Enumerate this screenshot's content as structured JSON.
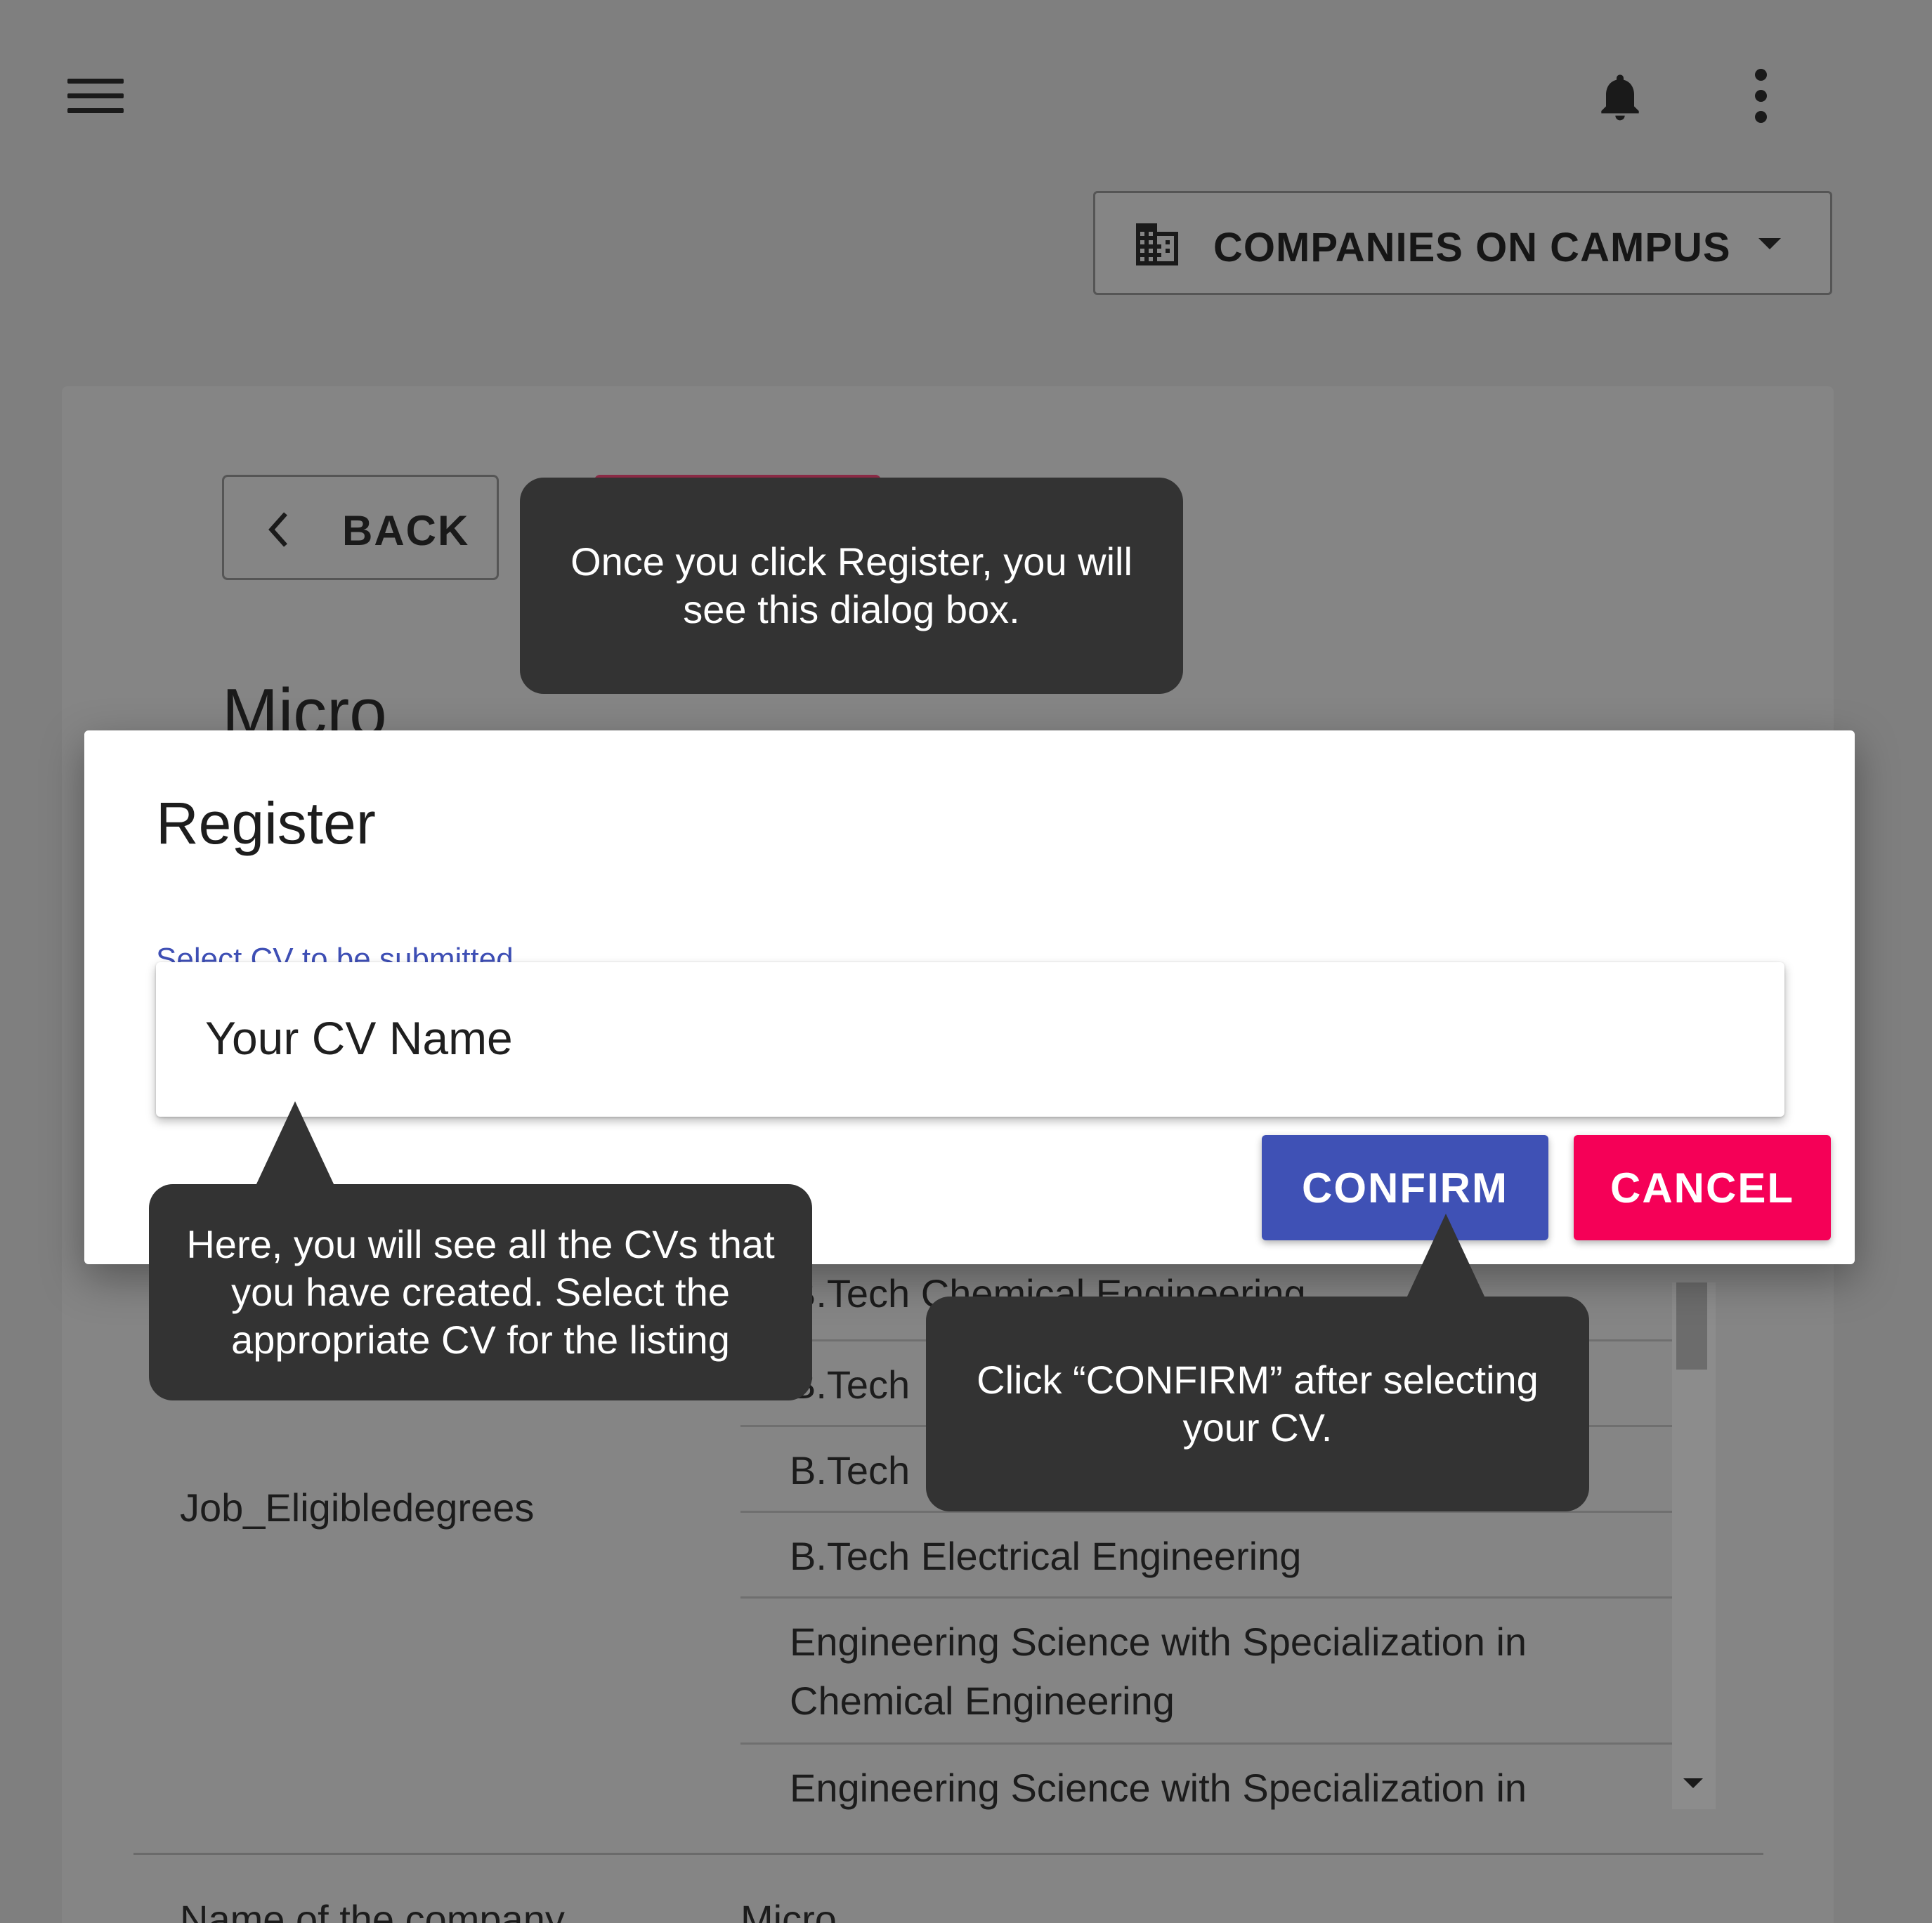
{
  "app_bar": {
    "menu_icon": "menu-icon",
    "notification_icon": "bell-icon",
    "overflow_icon": "more-vert-icon"
  },
  "company_selector": {
    "icon": "building-icon",
    "label": "COMPANIES ON CAMPUS",
    "caret_icon": "caret-down-icon"
  },
  "page": {
    "back_label": "BACK",
    "title": "Micro",
    "eligible_degrees_label": "Job_Eligibledegrees",
    "degrees": [
      "B.Tech Chemical Engineering",
      "B.Tech",
      "B.Tech",
      "B.Tech Electrical Engineering",
      "Engineering Science with Specialization in Chemical Engineering",
      "Engineering Science with Specialization in"
    ],
    "next_row_label": "Name of the company",
    "next_row_value": "Micro"
  },
  "dialog": {
    "title": "Register",
    "field_label": "Select CV to be submitted",
    "selected_cv": "Your CV Name",
    "confirm_label": "CONFIRM",
    "cancel_label": "CANCEL"
  },
  "callouts": {
    "register_hint": "Once you click Register, you will see this dialog box.",
    "cv_hint": "Here, you will see all the CVs that you have created. Select the appropriate CV for the listing",
    "confirm_hint": "Click “CONFIRM” after selecting your CV."
  },
  "colors": {
    "overlay": "#7f7f7f",
    "callout_bg": "#333333",
    "confirm": "#3f51b5",
    "cancel": "#f50057",
    "field_label": "#3e4fb5"
  }
}
